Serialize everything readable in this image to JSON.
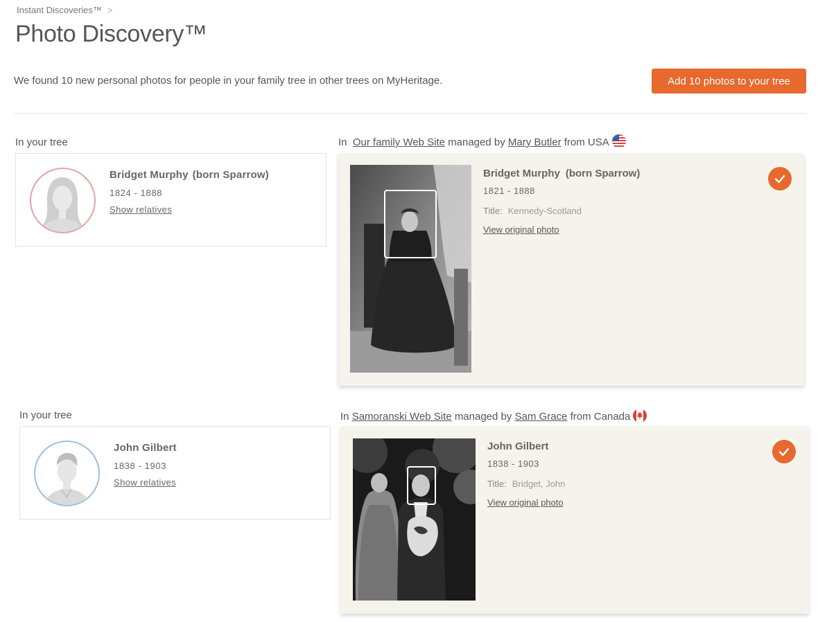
{
  "breadcrumb": {
    "parent": "Instant Discoveries™",
    "separator": ">"
  },
  "page_title": "Photo Discovery™",
  "summary": "We found 10 new personal photos for people in your family tree in other trees on MyHeritage.",
  "add_button": "Add 10 photos to your tree",
  "colors": {
    "accent": "#e7692e",
    "card_bg": "#f6f3ed",
    "female_ring": "#e3a3a6",
    "male_ring": "#9dbfdc"
  },
  "matches": [
    {
      "tree_label": "In your tree",
      "tree_person": {
        "name": "Bridget Murphy",
        "born": "(born Sparrow)",
        "dates": "1824 - 1888",
        "show_relatives": "Show relatives",
        "avatar": "female-avatar-icon"
      },
      "source": {
        "prefix": "In",
        "site": "Our family Web Site",
        "managed_by": "managed by",
        "manager": "Mary Butler",
        "from": "from USA",
        "flag": "usa-flag-icon"
      },
      "photo_person": {
        "name": "Bridget Murphy",
        "born": "(born Sparrow)",
        "dates": "1821 - 1888",
        "title_label": "Title:",
        "title_value": "Kennedy-Scotland",
        "view_link": "View original photo"
      }
    },
    {
      "tree_label": "In your tree",
      "tree_person": {
        "name": "John Gilbert",
        "dates": "1838 - 1903",
        "show_relatives": "Show relatives",
        "avatar": "male-avatar-icon"
      },
      "source": {
        "prefix": "In",
        "site": "Samoranski Web Site",
        "managed_by": "managed by",
        "manager": "Sam Grace",
        "from": "from Canada",
        "flag": "canada-flag-icon"
      },
      "photo_person": {
        "name": "John Gilbert",
        "dates": "1838 - 1903",
        "title_label": "Title:",
        "title_value": "Bridget, John",
        "view_link": "View original photo"
      }
    }
  ]
}
